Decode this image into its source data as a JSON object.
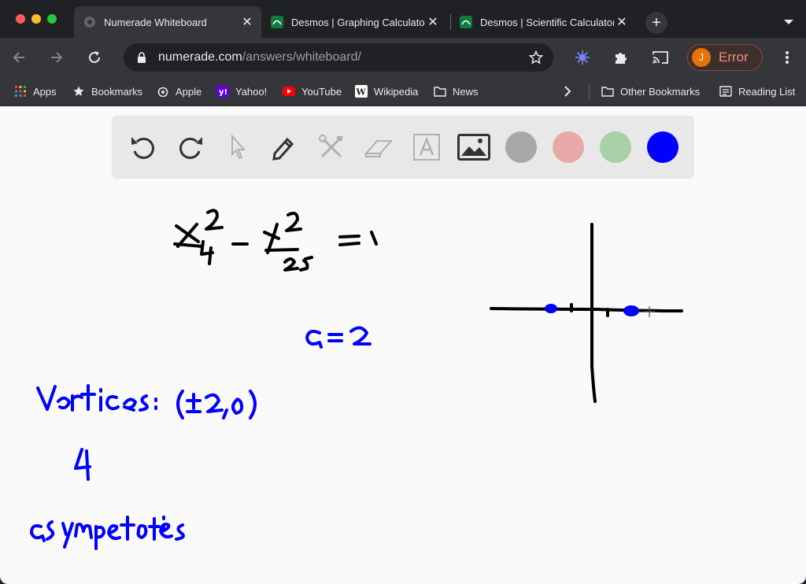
{
  "tabs": [
    {
      "title": "Numerade Whiteboard",
      "active": true
    },
    {
      "title": "Desmos | Graphing Calculator",
      "active": false
    },
    {
      "title": "Desmos | Scientific Calculator",
      "active": false
    }
  ],
  "address_bar": {
    "host": "numerade.com",
    "path": "/answers/whiteboard/"
  },
  "profile": {
    "initial": "J",
    "label": "Error"
  },
  "bookmarks": [
    {
      "label": "Apps",
      "icon": "apps-grid-icon"
    },
    {
      "label": "Bookmarks",
      "icon": "star-icon"
    },
    {
      "label": "Apple",
      "icon": "apple-icon"
    },
    {
      "label": "Yahoo!",
      "icon": "yahoo-icon"
    },
    {
      "label": "YouTube",
      "icon": "youtube-icon"
    },
    {
      "label": "Wikipedia",
      "icon": "wikipedia-icon"
    },
    {
      "label": "News",
      "icon": "folder-icon"
    }
  ],
  "other_bookmarks": "Other Bookmarks",
  "reading_list": "Reading List",
  "whiteboard": {
    "tools": [
      "undo-icon",
      "redo-icon",
      "pointer-icon",
      "pen-icon",
      "tools-icon",
      "eraser-icon",
      "text-icon",
      "image-icon"
    ],
    "swatches": [
      {
        "name": "gray",
        "color": "#a8a8a8"
      },
      {
        "name": "pink",
        "color": "#e8a8a8"
      },
      {
        "name": "green",
        "color": "#a8d0a8"
      },
      {
        "name": "blue",
        "color": "#0000ff",
        "selected": true
      }
    ],
    "handwritten_notes": [
      "x^2/4 - y^2/25 = 1",
      "a = 2",
      "Vertices: (±2,0)",
      "4",
      "asymptotes:"
    ]
  }
}
